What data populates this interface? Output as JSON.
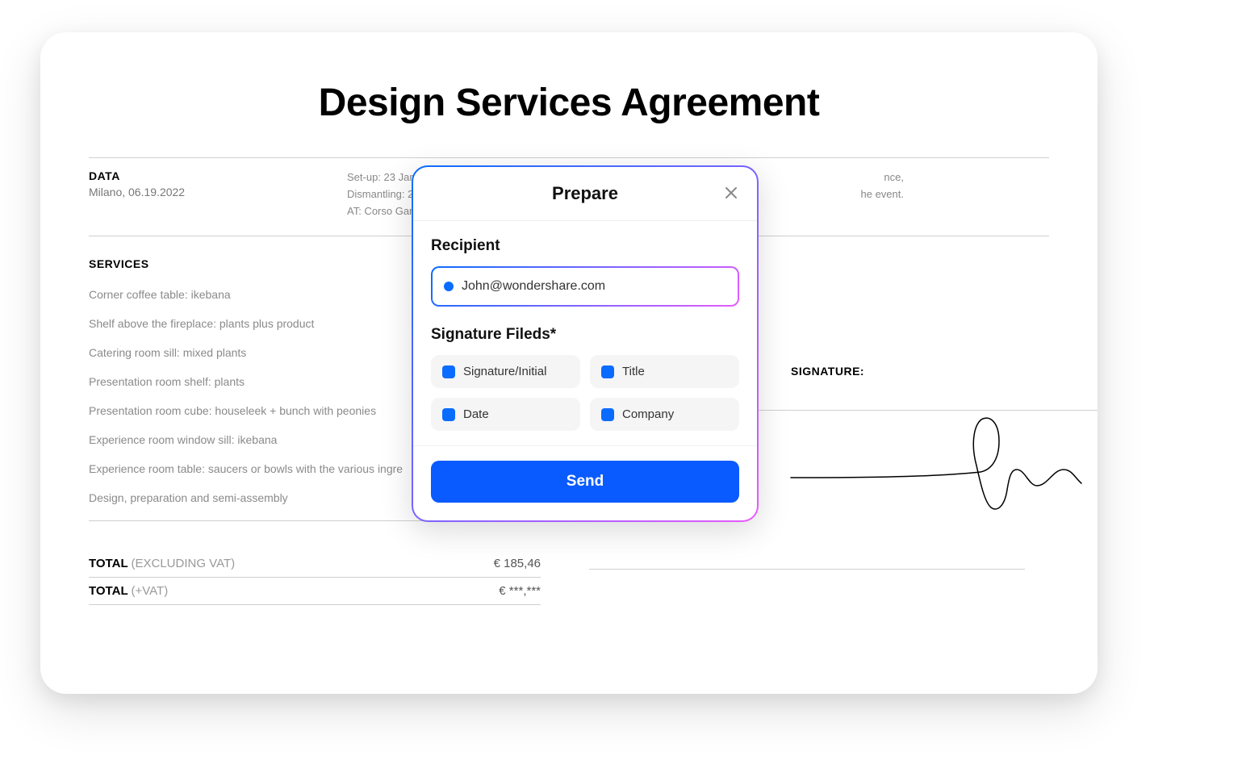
{
  "document": {
    "title": "Design Services Agreement",
    "data_label": "DATA",
    "data_value": "Milano, 06.19.2022",
    "meta_mid_line1": "Set-up: 23 Jan",
    "meta_mid_line2": "Dismantling: 2",
    "meta_mid_line3": "AT: Corso Gari",
    "meta_right_line1": "nce,",
    "meta_right_line2": "he event.",
    "services_label": "SERVICES",
    "services": [
      "Corner coffee table: ikebana",
      "Shelf above the fireplace: plants plus product",
      "Catering room sill: mixed plants",
      "Presentation room shelf: plants",
      "Presentation room cube: houseleek + bunch with peonies",
      "Experience room window sill: ikebana",
      "Experience room table: saucers or bowls with the various ingre",
      "Design, preparation and semi-assembly"
    ],
    "total_excl_label": "TOTAL ",
    "total_excl_suffix": "(EXCLUDING VAT)",
    "total_excl_value": "€ 185,46",
    "total_incl_label": "TOTAL ",
    "total_incl_suffix": "(+VAT)",
    "total_incl_value": "€ ***,***",
    "signature_label": "SIGNATURE:"
  },
  "modal": {
    "title": "Prepare",
    "recipient_label": "Recipient",
    "recipient_value": "John@wondershare.com",
    "fields_label": "Signature Fileds*",
    "field1": "Signature/Initial",
    "field2": "Title",
    "field3": "Date",
    "field4": "Company",
    "send_label": "Send"
  }
}
